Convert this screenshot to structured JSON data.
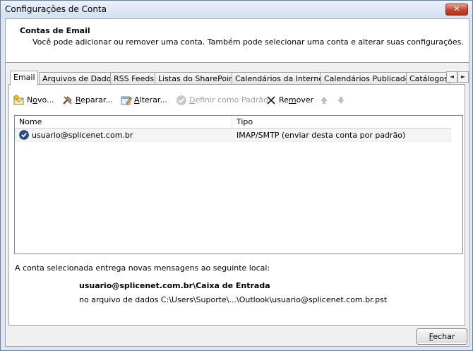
{
  "window": {
    "title": "Configurações de Conta",
    "close_glyph": "✕"
  },
  "header": {
    "title": "Contas de Email",
    "description": "Você pode adicionar ou remover uma conta. Também pode selecionar uma conta e alterar suas configurações."
  },
  "tabs": [
    {
      "label": "Email",
      "active": true
    },
    {
      "label": "Arquivos de Dados"
    },
    {
      "label": "RSS Feeds"
    },
    {
      "label": "Listas do SharePoint"
    },
    {
      "label": "Calendários da Internet"
    },
    {
      "label": "Calendários Publicados"
    },
    {
      "label": "Catálogos"
    }
  ],
  "toolbar": {
    "new_pre": "N",
    "new_u": "o",
    "new_post": "vo...",
    "repair_pre": "",
    "repair_u": "R",
    "repair_post": "eparar...",
    "change_pre": "",
    "change_u": "A",
    "change_post": "lterar...",
    "default_pre": "",
    "default_u": "D",
    "default_post": "efinir como Padrão",
    "remove_pre": "Re",
    "remove_u": "m",
    "remove_post": "over",
    "icons": [
      "new-mail-icon",
      "repair-icon",
      "change-icon",
      "default-check-icon",
      "remove-x-icon",
      "move-up-icon",
      "move-down-icon"
    ]
  },
  "list": {
    "columns": {
      "name": "Nome",
      "type": "Tipo"
    },
    "rows": [
      {
        "name": "usuario@splicenet.com.br",
        "type": "IMAP/SMTP (enviar desta conta por padrão)",
        "default": true
      }
    ]
  },
  "location": {
    "label": "A conta selecionada entrega novas mensagens ao seguinte local:",
    "path": "usuario@splicenet.com.br\\Caixa de Entrada",
    "file": "no arquivo de dados C:\\Users\\Suporte\\...\\Outlook\\usuario@splicenet.com.br.pst"
  },
  "footer": {
    "close_u": "F",
    "close_post": "echar"
  },
  "colors": {
    "accent": "#2a5aa0",
    "window_frame": "#6b7f96",
    "close_red": "#c2452c"
  }
}
